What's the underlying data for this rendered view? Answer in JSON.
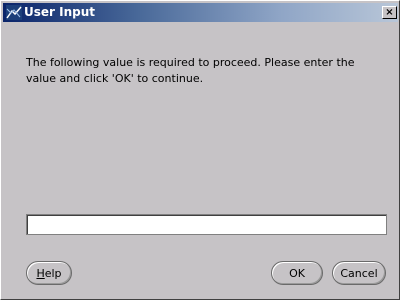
{
  "window": {
    "title": "User Input",
    "close_glyph": "×",
    "icon": "app-icon"
  },
  "dialog": {
    "message": "The following value is required to proceed. Please enter the value and click 'OK' to continue.",
    "input_value": ""
  },
  "buttons": {
    "help_mnemonic": "H",
    "help_rest": "elp",
    "ok": "OK",
    "cancel": "Cancel"
  },
  "colors": {
    "window_bg": "#c6c3c6",
    "titlebar_start": "#0a246a",
    "titlebar_end": "#b8c6d8",
    "title_text": "#ffffff",
    "input_bg": "#ffffff"
  }
}
